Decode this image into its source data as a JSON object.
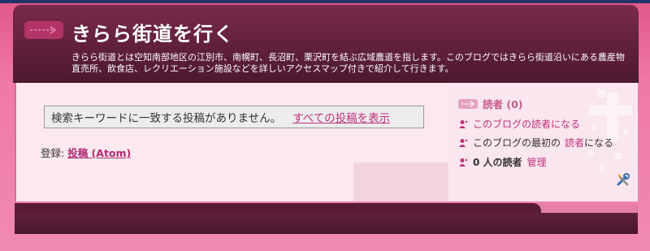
{
  "header": {
    "title": "きらら街道を行く",
    "description": "きらら街道とは空知南部地区の江別市、南幌町、長沼町、栗沢町を結ぶ広域農道を指します。このブログではきらら街道沿いにある農産物直売所、飲食店、レクリエーション施設などを詳しいアクセスマップ付きで紹介して行きます。"
  },
  "main": {
    "no_results_message": "検索キーワードに一致する投稿がありません。",
    "show_all_link": "すべての投稿を表示",
    "subscribe_label": "登録:",
    "subscribe_link": "投稿 (Atom)"
  },
  "sidebar": {
    "followers_title": "読者 (0)",
    "become_follower": "このブログの読者になる",
    "first_follower_prefix": "このブログの最初の",
    "first_follower_link": "読者",
    "first_follower_suffix": "になる",
    "reader_count": "0 人の読者",
    "manage_link": "管理"
  },
  "colors": {
    "accent": "#c0307a",
    "header_bg": "#5e1f39",
    "page_bg": "#f07aa6"
  }
}
